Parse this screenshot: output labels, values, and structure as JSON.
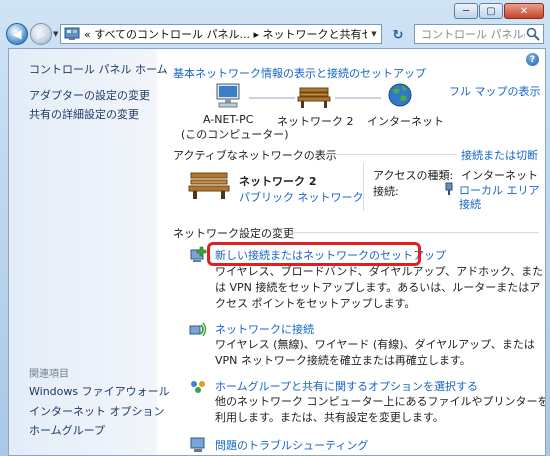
{
  "window": {
    "address_text": "« すべてのコントロール パネル... ▸ ネットワークと共有センター",
    "search_placeholder": "コントロール パネルの...",
    "buttons": {
      "minimize": "─",
      "maximize": "▢",
      "close": "✕"
    }
  },
  "sidebar": {
    "items": [
      "コントロール パネル ホーム",
      "アダプターの設定の変更",
      "共有の詳細設定の変更"
    ],
    "related_heading": "関連項目",
    "related": [
      "Windows ファイアウォール",
      "インターネット オプション",
      "ホームグループ"
    ]
  },
  "main": {
    "header_link": "基本ネットワーク情報の表示と接続のセットアップ",
    "full_map_link": "フル マップの表示",
    "map": {
      "pc_name": "A-NET-PC",
      "pc_sub": "(このコンピューター)",
      "network": "ネットワーク 2",
      "internet": "インターネット"
    },
    "active_section": "アクティブなネットワークの表示",
    "connect_disconnect": "接続または切断",
    "active_network": {
      "name": "ネットワーク 2",
      "type": "パブリック ネットワーク",
      "access_label": "アクセスの種類:",
      "access_value": "インターネット",
      "connection_label": "接続:",
      "connection_value_1": "ローカル エリア",
      "connection_value_2": "接続"
    },
    "change_section": "ネットワーク設定の変更",
    "tasks": [
      {
        "title": "新しい接続またはネットワークのセットアップ",
        "desc": "ワイヤレス、ブロードバンド、ダイヤルアップ、アドホック、または VPN 接続をセットアップします。あるいは、ルーターまたはアクセス ポイントをセットアップします。"
      },
      {
        "title": "ネットワークに接続",
        "desc": "ワイヤレス (無線)、ワイヤード (有線)、ダイヤルアップ、または VPN ネットワーク接続を確立または再確立します。"
      },
      {
        "title": "ホームグループと共有に関するオプションを選択する",
        "desc": "他のネットワーク コンピューター上にあるファイルやプリンターを利用します。または、共有設定を変更します。"
      },
      {
        "title": "問題のトラブルシューティング",
        "desc": ""
      }
    ]
  }
}
